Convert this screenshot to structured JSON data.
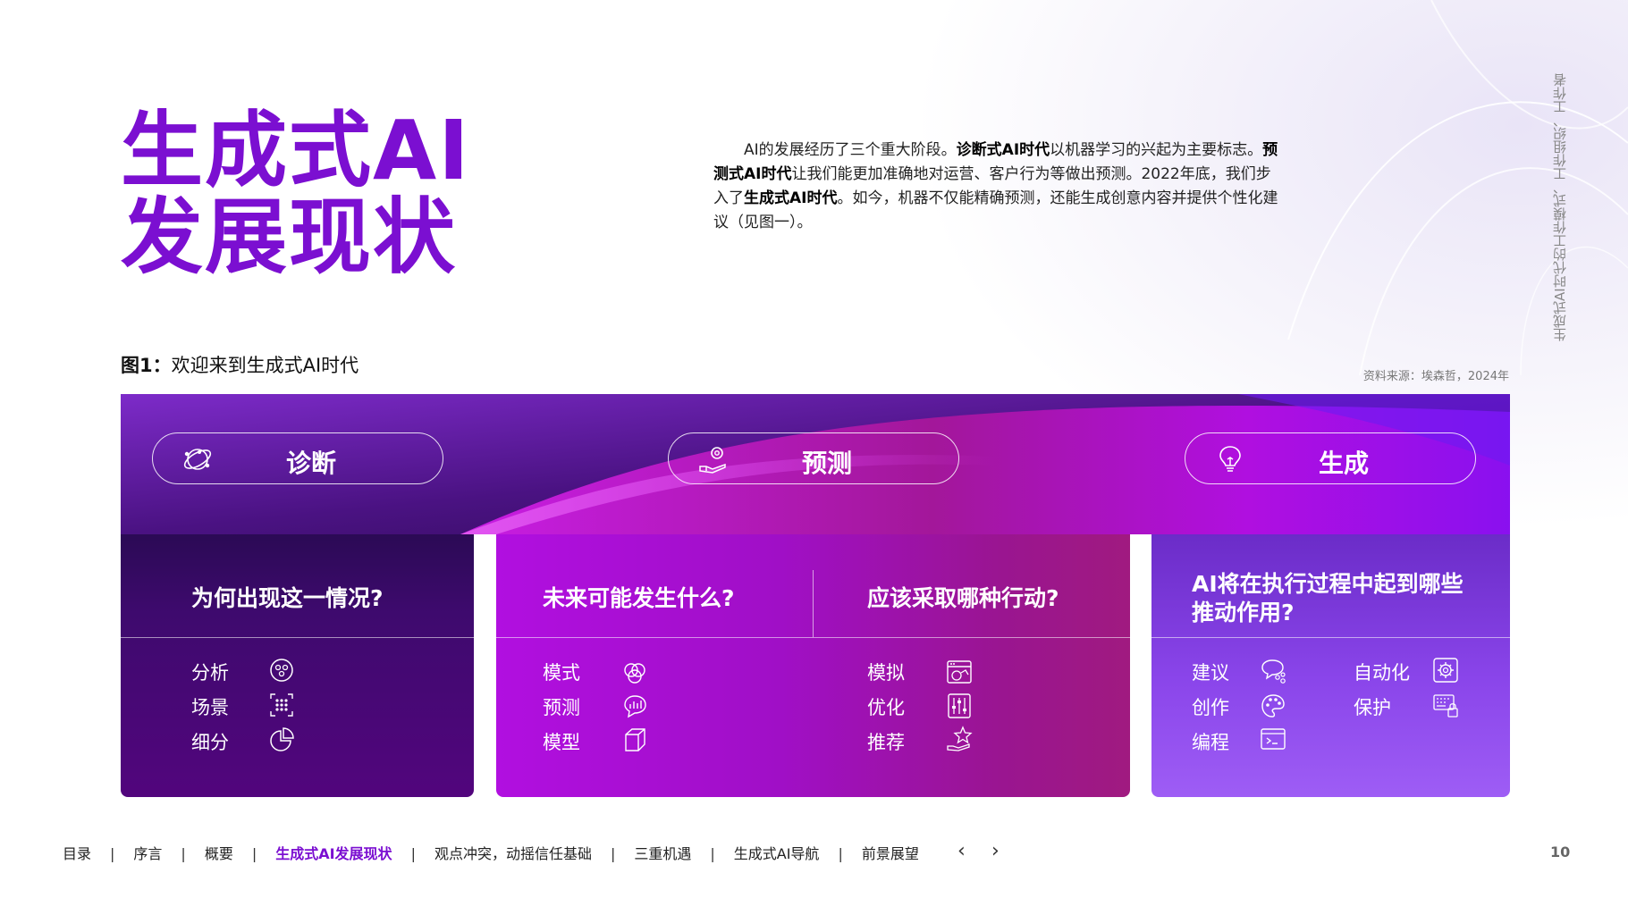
{
  "page": {
    "title_line1": "生成式AI",
    "title_line2": "发展现状",
    "side_text": "生成式AI时代的工作模式、工作组织、工作者",
    "page_number": "10"
  },
  "intro": {
    "p1": "AI的发展经历了三个重大阶段。",
    "b1": "诊断式AI时代",
    "p2": "以机器学习的兴起为主要标志。",
    "b2": "预测式AI时代",
    "p3": "让我们能更加准确地对运营、客户行为等做出预测。2022年底，我们步入了",
    "b3": "生成式AI时代",
    "p4": "。如今，机器不仅能精确预测，还能生成创意内容并提供个性化建议（见图一）。"
  },
  "figure": {
    "caption_label": "图1：",
    "caption_text": "欢迎来到生成式AI时代",
    "source": "资料来源：埃森哲，2024年"
  },
  "stages": [
    {
      "label": "诊断",
      "icon": "globe-orbit-icon"
    },
    {
      "label": "预测",
      "icon": "gear-hand-icon"
    },
    {
      "label": "生成",
      "icon": "lightbulb-icon"
    }
  ],
  "panels": {
    "diagnose": {
      "question": "为何出现这一情况?",
      "items": [
        {
          "label": "分析",
          "icon": "analysis-circle-icon"
        },
        {
          "label": "场景",
          "icon": "scatter-grid-icon"
        },
        {
          "label": "细分",
          "icon": "pie-chart-icon"
        }
      ]
    },
    "predict": {
      "question_left": "未来可能发生什么?",
      "question_right": "应该采取哪种行动?",
      "items_left": [
        {
          "label": "模式",
          "icon": "venn-circles-icon"
        },
        {
          "label": "预测",
          "icon": "chart-bubble-icon"
        },
        {
          "label": "模型",
          "icon": "cube-icon"
        }
      ],
      "items_right": [
        {
          "label": "模拟",
          "icon": "simulation-window-icon"
        },
        {
          "label": "优化",
          "icon": "sliders-icon"
        },
        {
          "label": "推荐",
          "icon": "star-hand-icon"
        }
      ]
    },
    "generate": {
      "question_line1": "AI将在执行过程中起到哪些",
      "question_line2": "推动作用?",
      "items_left": [
        {
          "label": "建议",
          "icon": "chat-bubble-icon"
        },
        {
          "label": "创作",
          "icon": "palette-icon"
        },
        {
          "label": "编程",
          "icon": "terminal-icon"
        }
      ],
      "items_right": [
        {
          "label": "自动化",
          "icon": "gear-box-icon"
        },
        {
          "label": "保护",
          "icon": "keyboard-lock-icon"
        }
      ]
    }
  },
  "footer": {
    "nav": [
      "目录",
      "序言",
      "概要",
      "生成式AI发展现状",
      "观点冲突，动摇信任基础",
      "三重机遇",
      "生成式AI导航",
      "前景展望"
    ],
    "separator": "|",
    "prev": "‹",
    "next": "›"
  },
  "colors": {
    "accent": "#7b0fd1",
    "banner_dark": "#3a0a6a",
    "magenta": "#c21be0"
  }
}
